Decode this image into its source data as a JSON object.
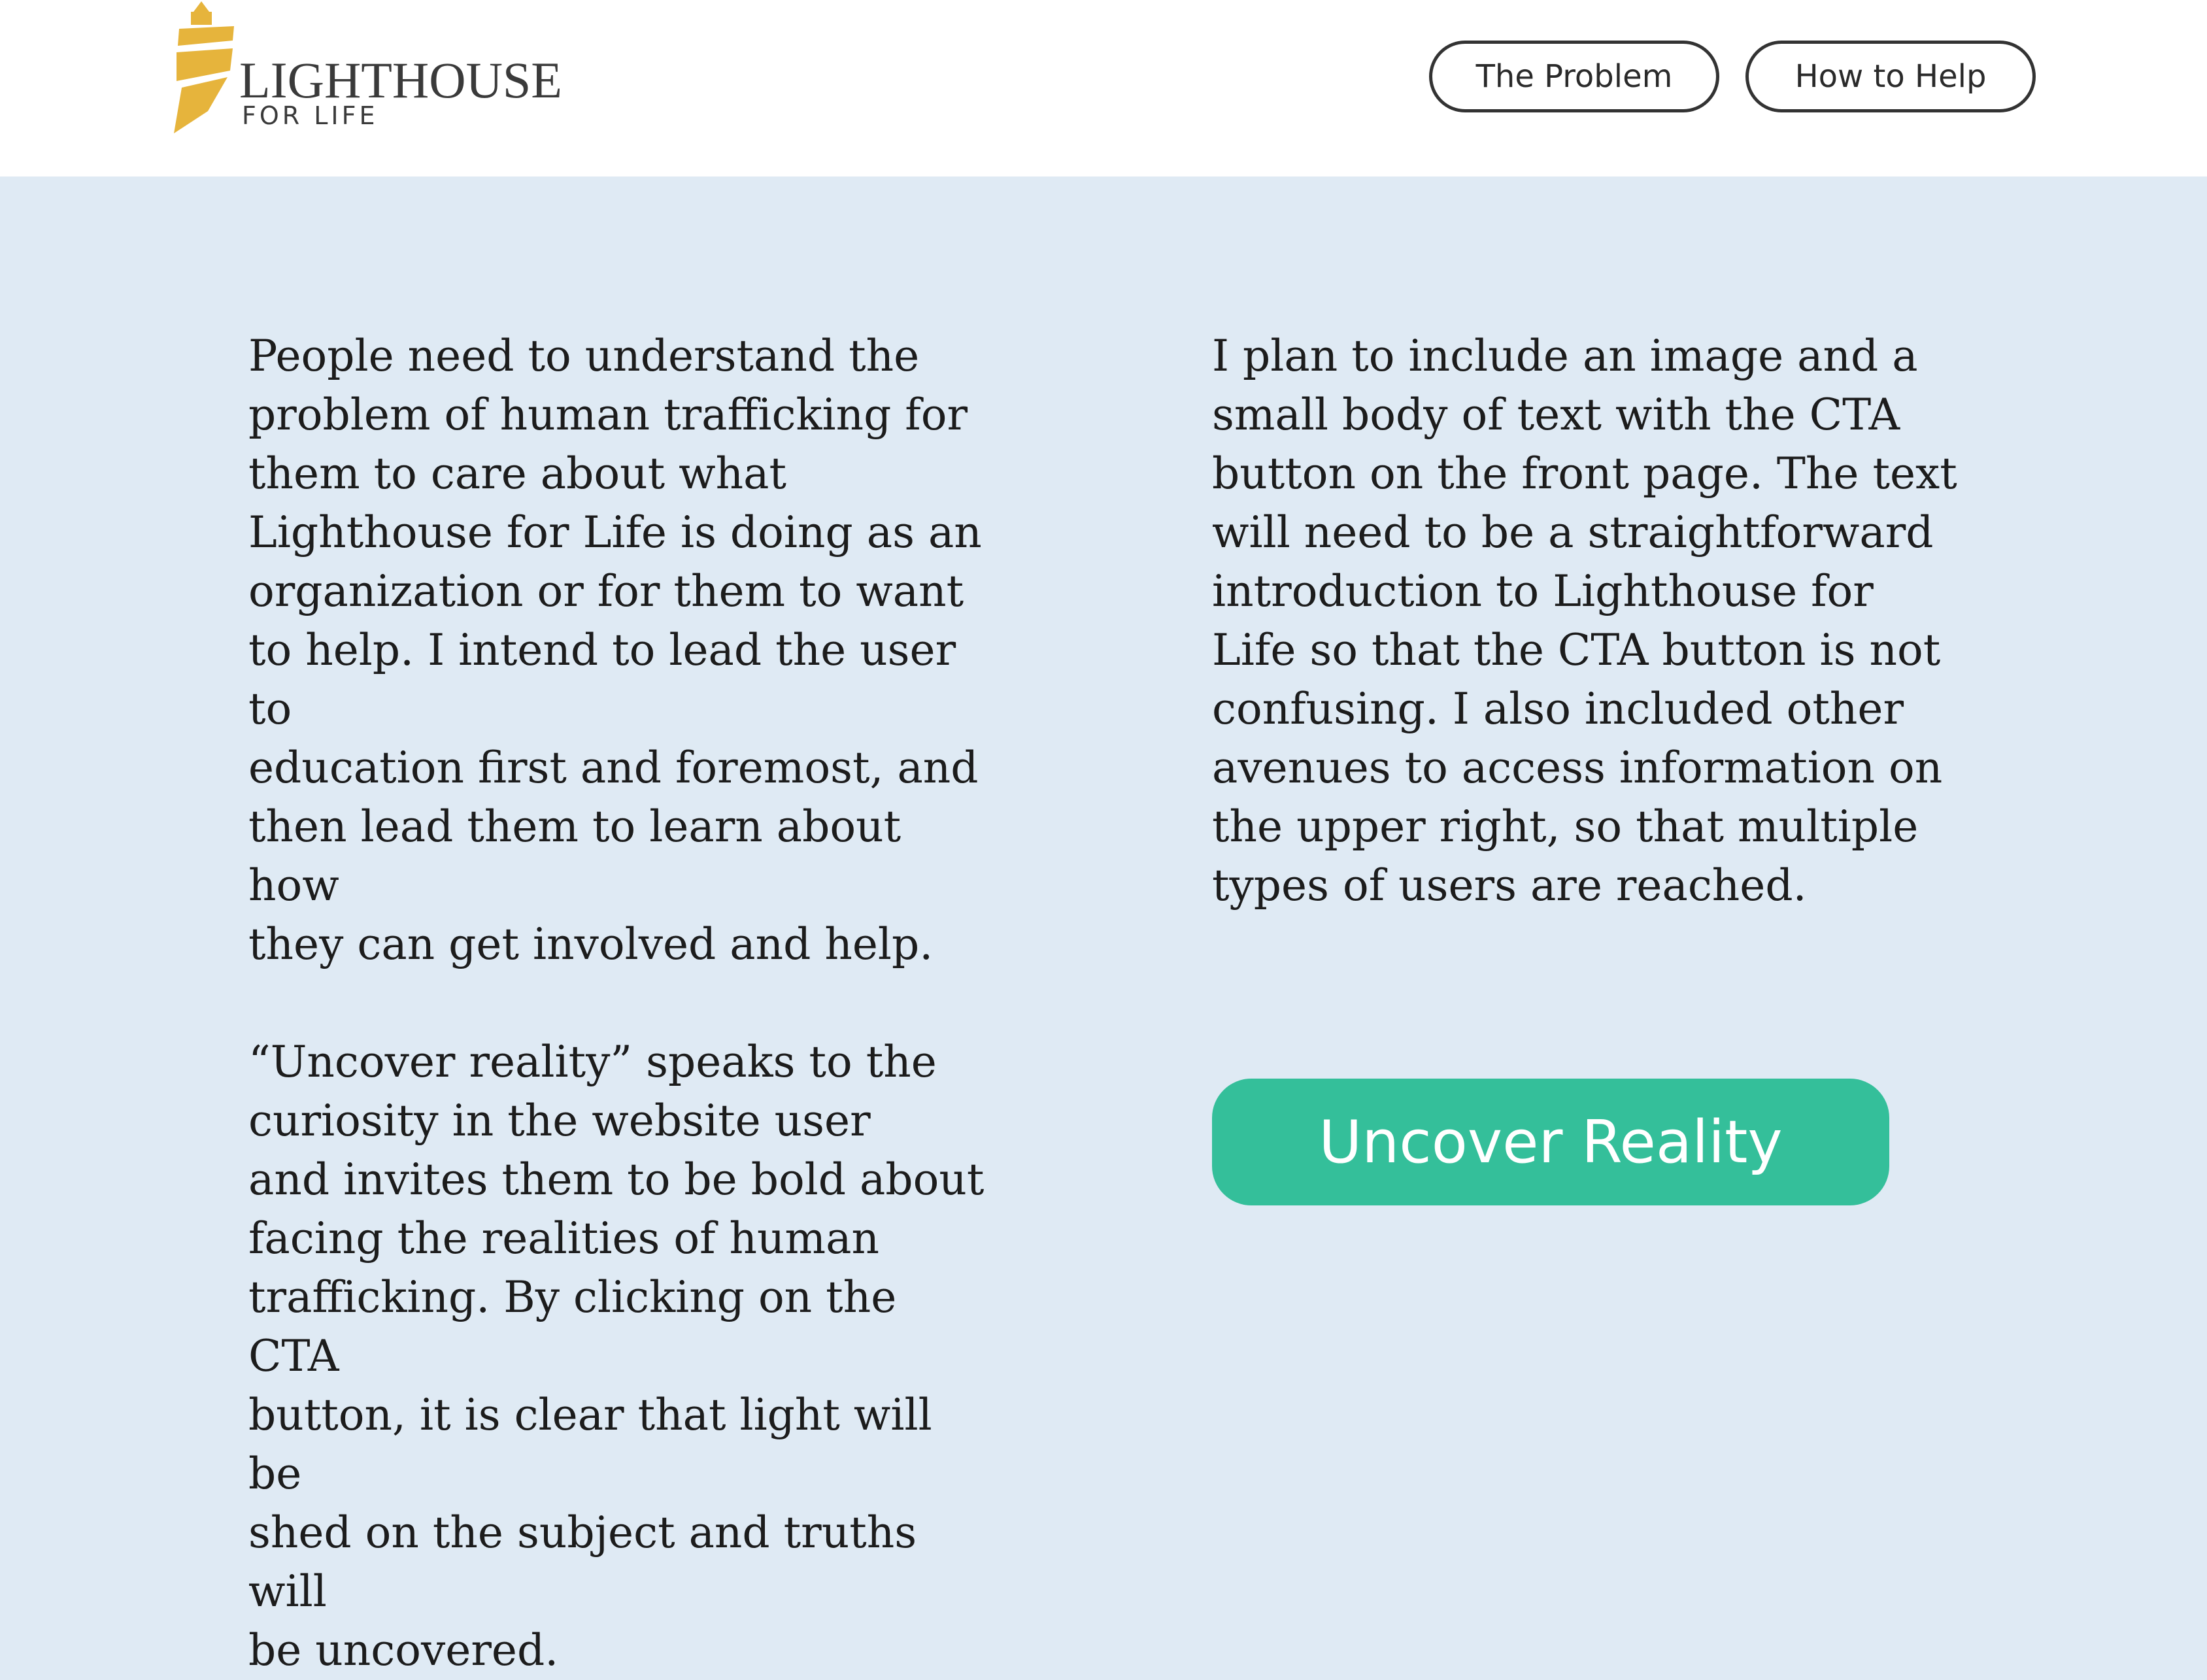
{
  "header": {
    "logo": {
      "title": "LIGHTHOUSE",
      "subtitle": "FOR LIFE",
      "icon": "lighthouse-icon",
      "color": "#e6b43c"
    },
    "nav": {
      "problem_label": "The Problem",
      "help_label": "How to Help"
    }
  },
  "main": {
    "left_paragraph_1": "People need to understand the\nproblem of human trafficking for\nthem to care about what\nLighthouse for Life is doing as an\norganization or for them to want\nto help.  I intend to lead the user to\neducation first and foremost, and\nthen lead them to learn about how\nthey can get involved and help.",
    "left_paragraph_2": "“Uncover reality” speaks to the\ncuriosity in the website user\nand invites them to be bold about\nfacing the realities of human\ntrafficking.  By clicking on the CTA\nbutton, it is clear that light will be\nshed on the subject and truths will\nbe uncovered.",
    "right_paragraph": "I plan to include an image and a\nsmall body of text with the CTA\nbutton on the front page. The text\nwill need to be a straightforward\nintroduction to Lighthouse for\nLife so that the CTA button is not\nconfusing. I also included other\navenues to access information on\nthe upper right, so that multiple\ntypes of users are reached.",
    "cta_label": "Uncover Reality"
  },
  "colors": {
    "background": "#dfeaf4",
    "cta": "#34bf9a",
    "logo_gold": "#e6b43c"
  }
}
